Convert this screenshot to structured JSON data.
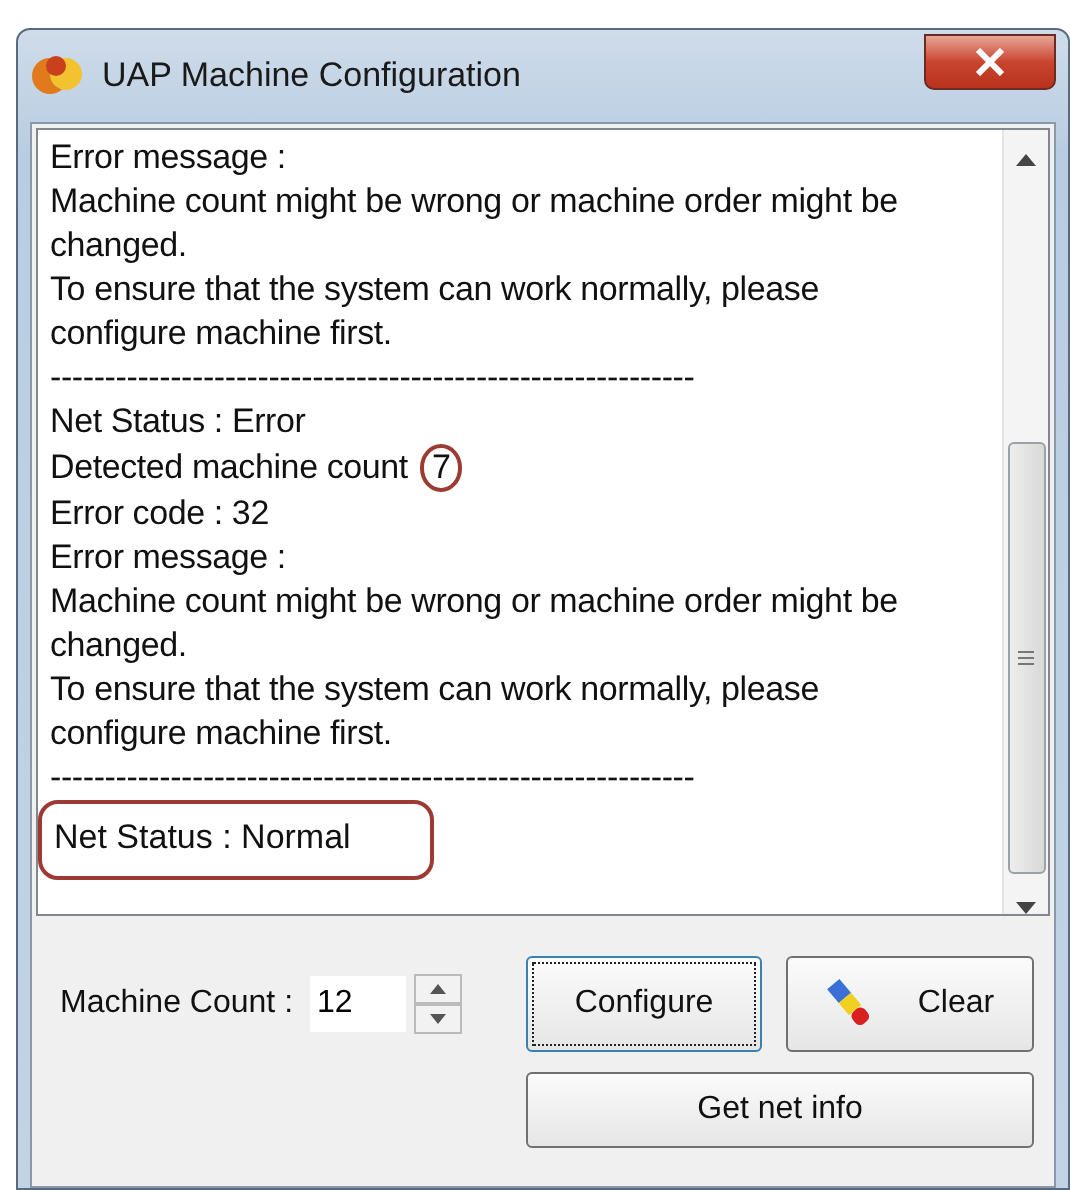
{
  "window": {
    "title": "UAP Machine Configuration"
  },
  "log": [
    {
      "kind": "text",
      "text": "Error message :"
    },
    {
      "kind": "text",
      "text": "Machine count might be wrong or machine order might be"
    },
    {
      "kind": "text",
      "text": "changed."
    },
    {
      "kind": "text",
      "text": "To ensure that the system can work normally, please"
    },
    {
      "kind": "text",
      "text": "configure machine first."
    },
    {
      "kind": "separator",
      "text": "-----------------------------------------------------------"
    },
    {
      "kind": "text",
      "text": "Net Status : Error"
    },
    {
      "kind": "value",
      "text": "Detected machine count",
      "value": "7",
      "circled": true
    },
    {
      "kind": "text",
      "text": "Error code : 32"
    },
    {
      "kind": "text",
      "text": "Error message :"
    },
    {
      "kind": "text",
      "text": "Machine count might be wrong or machine order might be"
    },
    {
      "kind": "text",
      "text": "changed."
    },
    {
      "kind": "text",
      "text": "To ensure that the system can work normally, please"
    },
    {
      "kind": "text",
      "text": "configure machine first."
    },
    {
      "kind": "separator",
      "text": "-----------------------------------------------------------"
    },
    {
      "kind": "circled",
      "text": "Net Status : Normal"
    }
  ],
  "machine_count": {
    "label": "Machine Count :",
    "value": "12"
  },
  "buttons": [
    {
      "kind": "configure",
      "label": "Configure",
      "focused": true
    },
    {
      "kind": "clear",
      "label": "Clear",
      "focused": false
    },
    {
      "kind": "info",
      "label": "Get net info",
      "focused": false
    }
  ]
}
